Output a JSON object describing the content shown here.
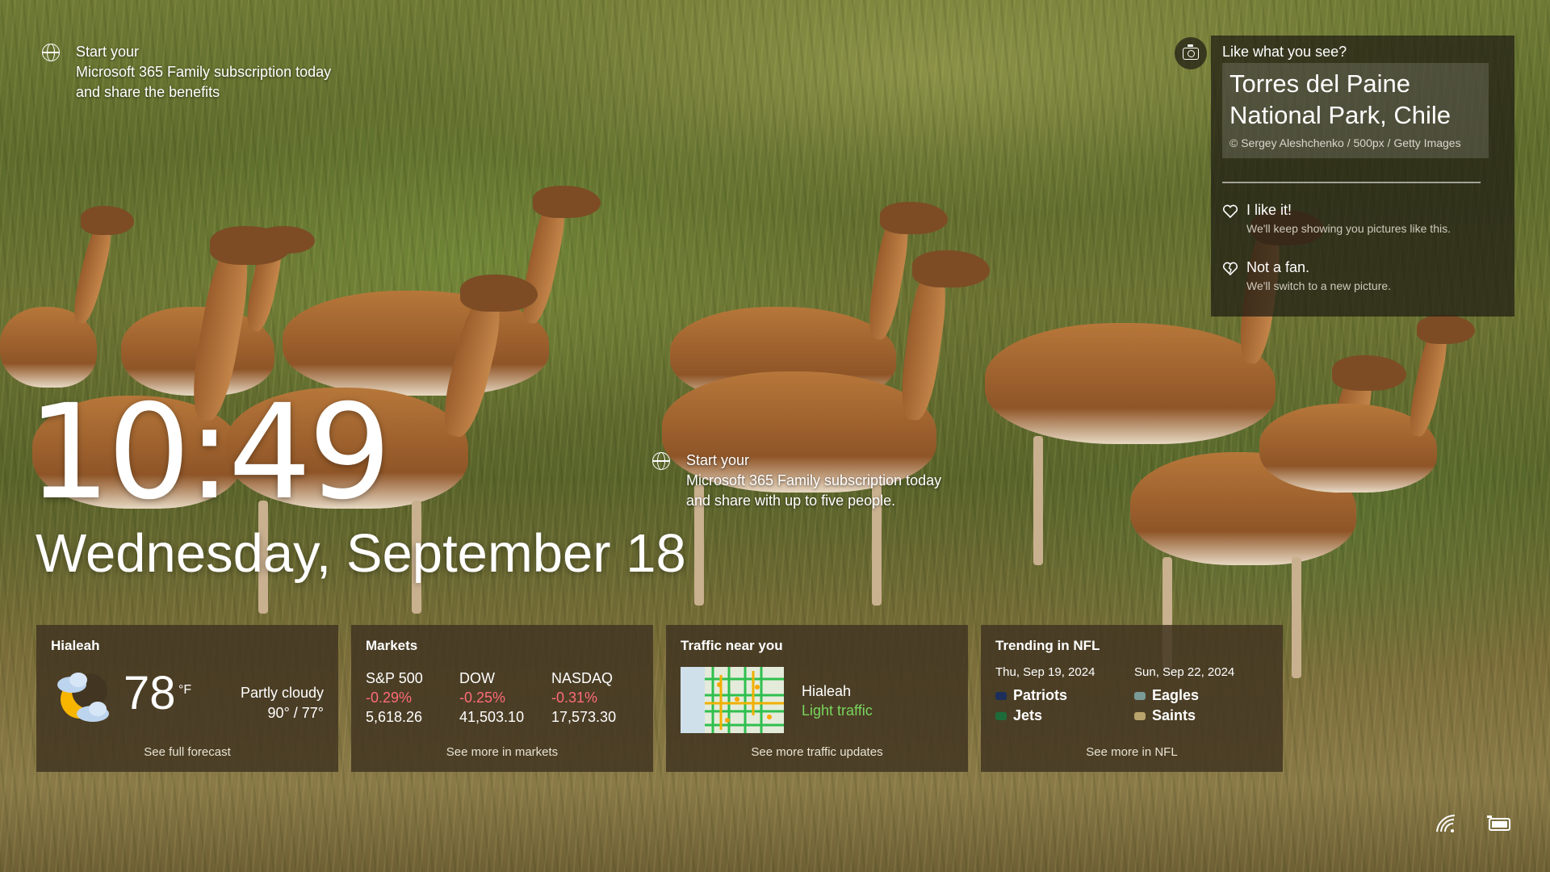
{
  "promo_top": {
    "line1": "Start your",
    "line2": "Microsoft 365 Family subscription today",
    "line3": "and share the benefits"
  },
  "promo_mid": {
    "line1": "Start your",
    "line2": "Microsoft 365 Family subscription today",
    "line3": "and share with up to five people."
  },
  "spotlight": {
    "header": "Like what you see?",
    "title": "Torres del Paine National Park, Chile",
    "credit": "© Sergey Aleshchenko / 500px / Getty Images",
    "like_title": "I like it!",
    "like_sub": "We'll keep showing you pictures like this.",
    "dislike_title": "Not a fan.",
    "dislike_sub": "We'll switch to a new picture."
  },
  "clock": {
    "time": "10:49",
    "date": "Wednesday, September 18"
  },
  "weather": {
    "title": "Hialeah",
    "temp": "78",
    "unit": "°F",
    "condition": "Partly cloudy",
    "range": "90° / 77°",
    "link": "See full forecast",
    "icon": "partly-cloudy-night-icon"
  },
  "markets": {
    "title": "Markets",
    "items": [
      {
        "name": "S&P 500",
        "change": "-0.29%",
        "value": "5,618.26"
      },
      {
        "name": "DOW",
        "change": "-0.25%",
        "value": "41,503.10"
      },
      {
        "name": "NASDAQ",
        "change": "-0.31%",
        "value": "17,573.30"
      }
    ],
    "link": "See more in markets",
    "down_color": "#ff6b78"
  },
  "traffic": {
    "title": "Traffic near you",
    "city": "Hialeah",
    "status": "Light traffic",
    "link": "See more traffic updates",
    "status_color": "#78d65d"
  },
  "nfl": {
    "title": "Trending in NFL",
    "games": [
      {
        "date": "Thu, Sep 19, 2024",
        "team1": "Patriots",
        "team2": "Jets"
      },
      {
        "date": "Sun, Sep 22, 2024",
        "team1": "Eagles",
        "team2": "Saints"
      }
    ],
    "link": "See more in NFL"
  },
  "system_tray": {
    "icons": [
      "wifi-icon",
      "battery-icon"
    ]
  }
}
